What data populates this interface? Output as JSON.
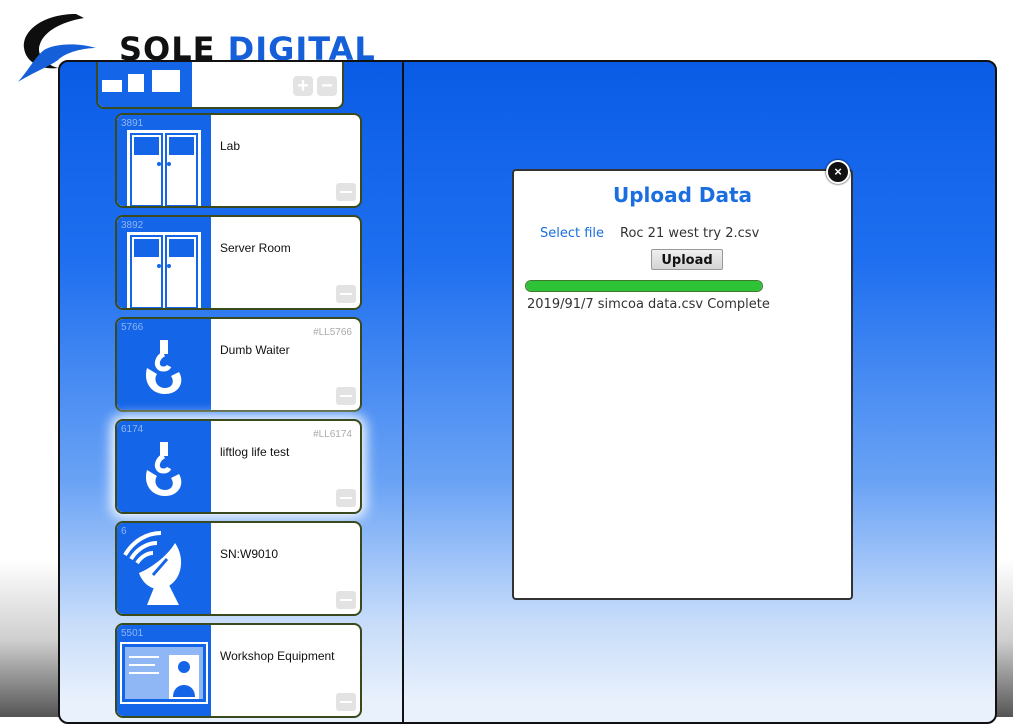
{
  "brand": {
    "name_part1": "SOLE ",
    "name_part2": "DIGITAL"
  },
  "devices": [
    {
      "id": "3891",
      "name": "Lab",
      "tag": "",
      "icon": "door-icon"
    },
    {
      "id": "3892",
      "name": "Server Room",
      "tag": "",
      "icon": "door-icon"
    },
    {
      "id": "5766",
      "name": "Dumb Waiter",
      "tag": "#LL5766",
      "icon": "hook-icon"
    },
    {
      "id": "6174",
      "name": "liftlog life test",
      "tag": "#LL6174",
      "icon": "hook-icon"
    },
    {
      "id": "6",
      "name": "SN:W9010",
      "tag": "",
      "icon": "satellite-dish-icon"
    },
    {
      "id": "5501",
      "name": "Workshop Equipment",
      "tag": "",
      "icon": "screen-icon"
    }
  ],
  "top_group": {
    "add_label": "+",
    "remove_label": "−"
  },
  "upload_dialog": {
    "title": "Upload Data",
    "select_file_label": "Select file",
    "selected_file": "Roc 21 west try 2.csv",
    "upload_button": "Upload",
    "progress_fraction": 1.0,
    "status_text": "2019/91/7 simcoa data.csv Complete",
    "close_label": "×"
  },
  "colors": {
    "brand_blue": "#1560d8",
    "panel_blue": "#0a5ce6",
    "progress_green": "#2ec236"
  }
}
